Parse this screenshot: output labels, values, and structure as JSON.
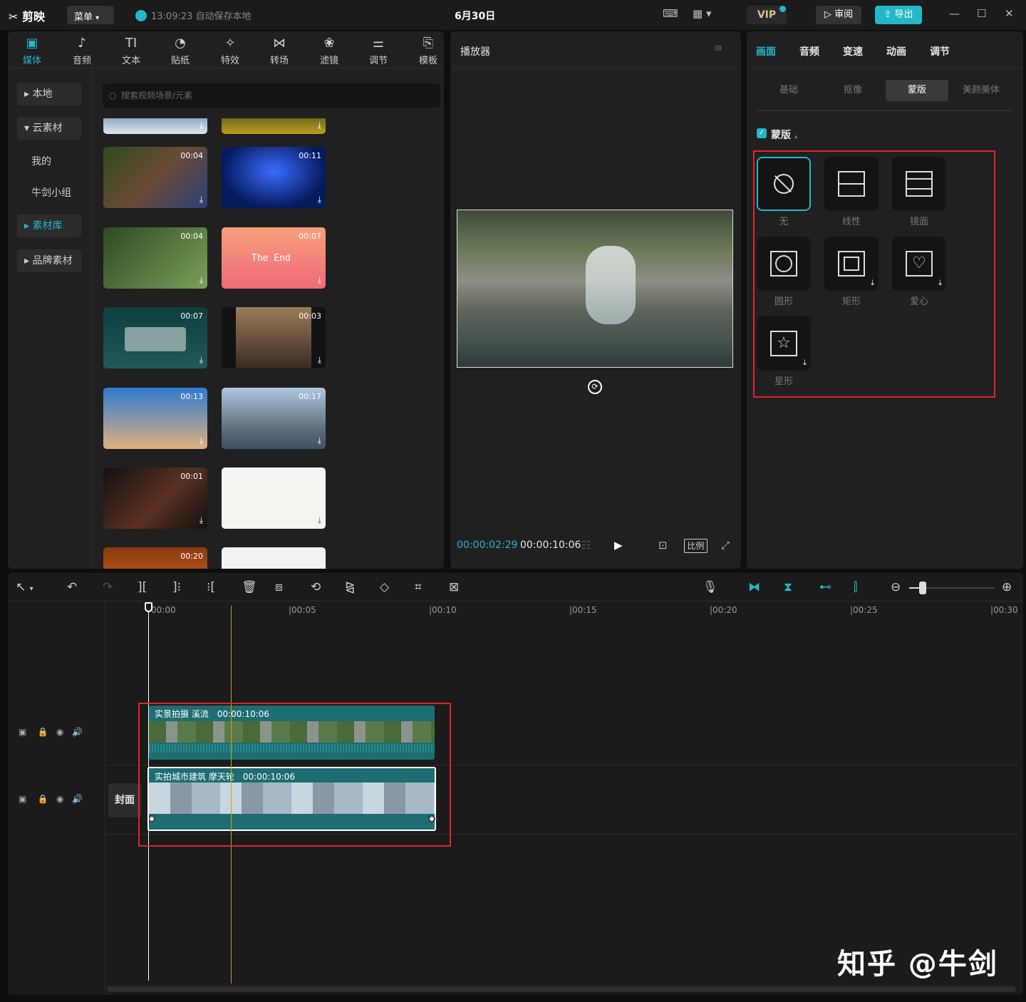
{
  "titlebar": {
    "app_name": "剪映",
    "menu_label": "菜单",
    "save_status": "13:09:23 自动保存本地",
    "window_title": "6月30日",
    "vip_label": "VIP",
    "review_label": "审阅",
    "export_label": "导出"
  },
  "toolbar": {
    "tabs": [
      {
        "label": "媒体",
        "icon": "media-icon"
      },
      {
        "label": "音频",
        "icon": "audio-icon"
      },
      {
        "label": "文本",
        "icon": "text-icon"
      },
      {
        "label": "贴纸",
        "icon": "sticker-icon"
      },
      {
        "label": "特效",
        "icon": "effects-icon"
      },
      {
        "label": "转场",
        "icon": "transition-icon"
      },
      {
        "label": "滤镜",
        "icon": "filter-icon"
      },
      {
        "label": "调节",
        "icon": "adjust-icon"
      },
      {
        "label": "模板",
        "icon": "template-icon"
      }
    ],
    "active": "媒体"
  },
  "sidebar": {
    "items": [
      "本地",
      "云素材",
      "我的",
      "牛剑小组",
      "素材库",
      "品牌素材"
    ]
  },
  "library": {
    "search_placeholder": "搜索视频场景/元素",
    "durations": [
      "00:04",
      "00:11",
      "00:04",
      "00:07",
      "00:07",
      "00:03",
      "00:13",
      "00:17",
      "00:01",
      "",
      "00:20",
      ""
    ],
    "the_end_text": "The End"
  },
  "player": {
    "title": "播放器",
    "current_time": "00:00:02:29",
    "total_time": "00:00:10:06",
    "ratio_label": "比例"
  },
  "inspector": {
    "tabs": [
      "画面",
      "音频",
      "变速",
      "动画",
      "调节"
    ],
    "subtabs": [
      "基础",
      "抠像",
      "蒙版",
      "美颜美体"
    ],
    "mask_section_label": "蒙版",
    "masks": [
      "无",
      "线性",
      "镜面",
      "圆形",
      "矩形",
      "爱心",
      "星形"
    ]
  },
  "timeline": {
    "ruler": [
      "00:00",
      "00:05",
      "00:10",
      "00:15",
      "00:20",
      "00:25",
      "00:30"
    ],
    "cover_label": "封面",
    "clips": [
      {
        "name": "实景拍摄 溪流",
        "duration": "00:00:10:06"
      },
      {
        "name": "实拍城市建筑 摩天轮",
        "duration": "00:00:10:06"
      }
    ]
  },
  "watermark": "知乎 @牛剑",
  "colors": {
    "accent": "#22b8c8",
    "highlight_box": "#e0242a",
    "clip": "#1d6d71"
  }
}
